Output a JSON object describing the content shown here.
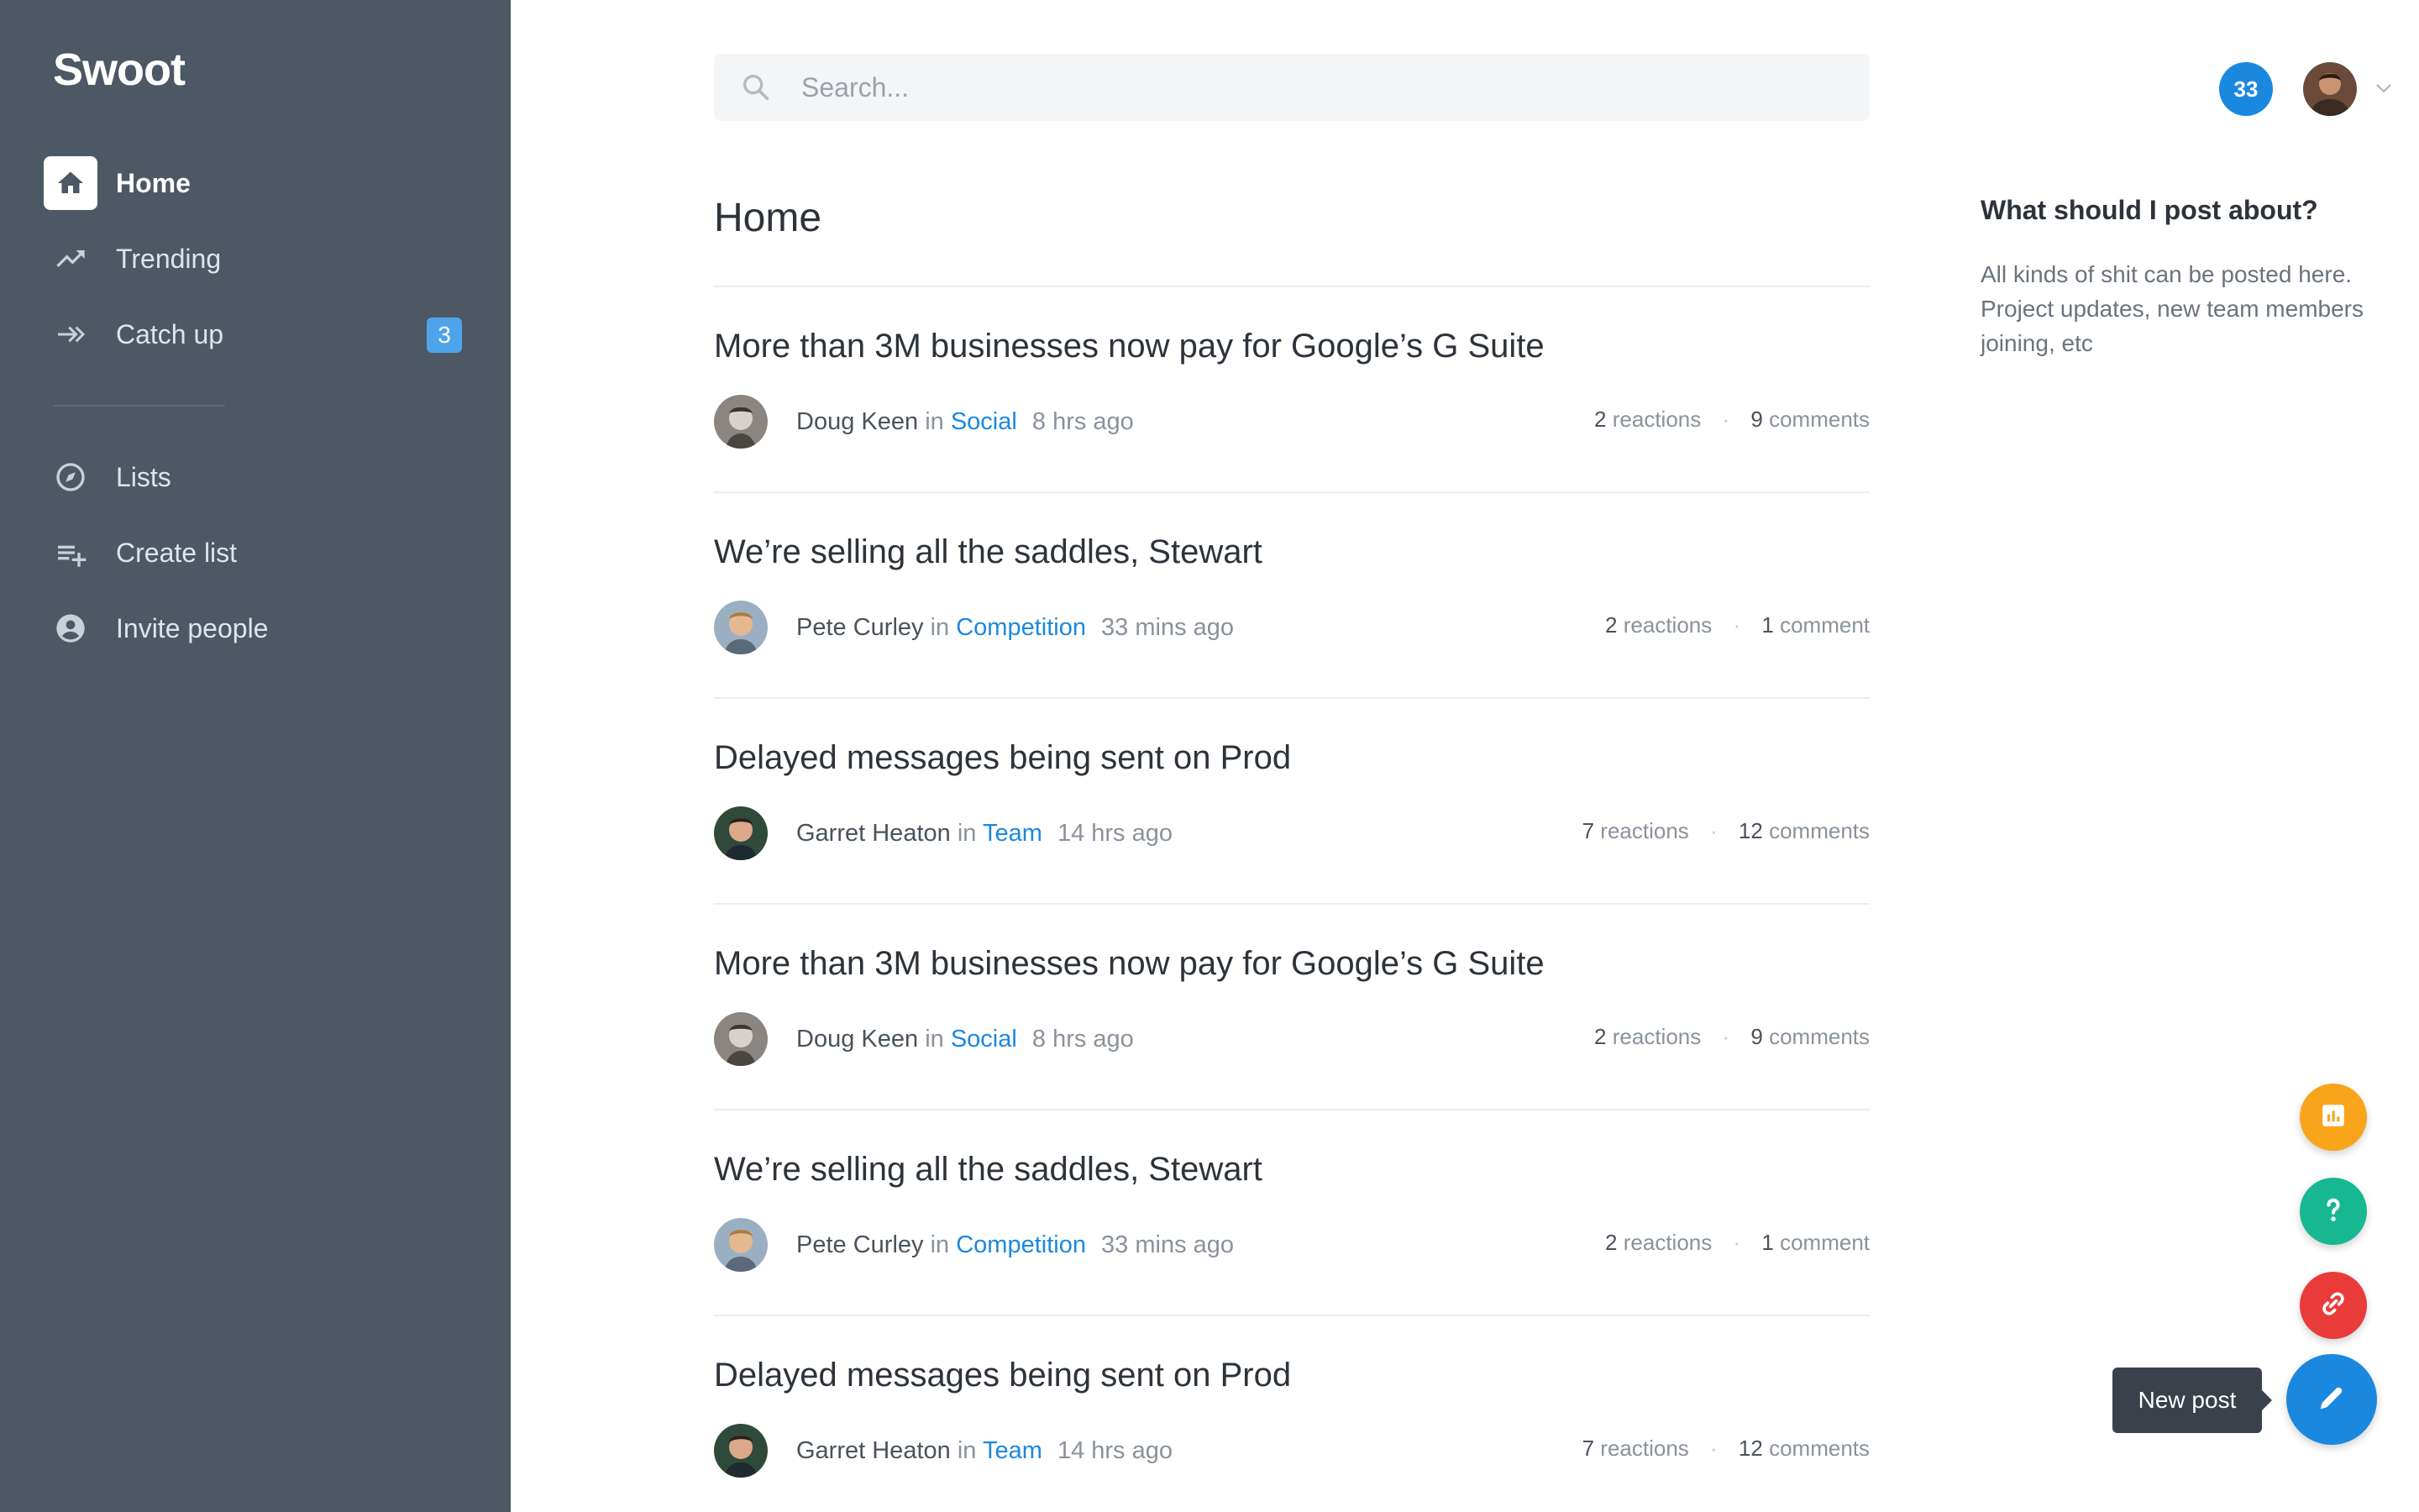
{
  "app": {
    "brand": "Swoot"
  },
  "sidebar": {
    "items": [
      {
        "label": "Home",
        "icon": "home-icon",
        "active": true
      },
      {
        "label": "Trending",
        "icon": "trending-icon"
      },
      {
        "label": "Catch up",
        "icon": "catch-up-icon",
        "badge": "3"
      }
    ],
    "secondary": [
      {
        "label": "Lists",
        "icon": "compass-icon"
      },
      {
        "label": "Create list",
        "icon": "playlist-add-icon"
      },
      {
        "label": "Invite people",
        "icon": "account-circle-icon"
      }
    ]
  },
  "search": {
    "placeholder": "Search..."
  },
  "header": {
    "notifications_count": "33"
  },
  "page": {
    "title": "Home"
  },
  "posts": [
    {
      "title": "More than 3M businesses now pay for Google’s G Suite",
      "author": "Doug Keen",
      "in": "in",
      "channel": "Social",
      "time": "8 hrs ago",
      "reactions": "2",
      "reactions_label": "reactions",
      "comments": "9",
      "comments_label": "comments"
    },
    {
      "title": "We’re selling all the saddles, Stewart",
      "author": "Pete Curley",
      "in": "in",
      "channel": "Competition",
      "time": "33 mins ago",
      "reactions": "2",
      "reactions_label": "reactions",
      "comments": "1",
      "comments_label": "comment"
    },
    {
      "title": "Delayed messages being sent on Prod",
      "author": "Garret Heaton",
      "in": "in",
      "channel": "Team",
      "time": "14 hrs ago",
      "reactions": "7",
      "reactions_label": "reactions",
      "comments": "12",
      "comments_label": "comments"
    },
    {
      "title": "More than 3M businesses now pay for Google’s G Suite",
      "author": "Doug Keen",
      "in": "in",
      "channel": "Social",
      "time": "8 hrs ago",
      "reactions": "2",
      "reactions_label": "reactions",
      "comments": "9",
      "comments_label": "comments"
    },
    {
      "title": "We’re selling all the saddles, Stewart",
      "author": "Pete Curley",
      "in": "in",
      "channel": "Competition",
      "time": "33 mins ago",
      "reactions": "2",
      "reactions_label": "reactions",
      "comments": "1",
      "comments_label": "comment"
    },
    {
      "title": "Delayed messages being sent on Prod",
      "author": "Garret Heaton",
      "in": "in",
      "channel": "Team",
      "time": "14 hrs ago",
      "reactions": "7",
      "reactions_label": "reactions",
      "comments": "12",
      "comments_label": "comments"
    }
  ],
  "aside": {
    "title": "What should I post about?",
    "body": "All kinds of shit can be posted here. Project updates, new team members joining, etc"
  },
  "fabs": {
    "new_post_tooltip": "New post"
  },
  "colors": {
    "sidebar": "#4d5864",
    "accent": "#1b88e0",
    "chart_fab": "#f8a51c",
    "help_fab": "#17b891",
    "link_fab": "#ea3b3b"
  }
}
